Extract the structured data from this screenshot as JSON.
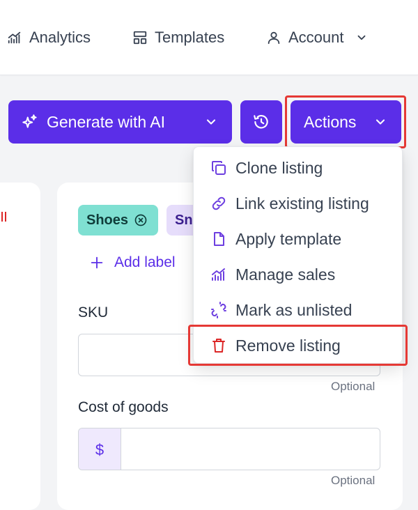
{
  "nav": {
    "items": [
      {
        "label": "Analytics",
        "icon": "chart-icon"
      },
      {
        "label": "Templates",
        "icon": "layout-icon"
      },
      {
        "label": "Account",
        "icon": "user-icon"
      }
    ]
  },
  "toolbar": {
    "generate_label": "Generate with AI",
    "actions_label": "Actions"
  },
  "labels": {
    "chips": [
      "Shoes",
      "Sn"
    ],
    "add_label": "Add label"
  },
  "form": {
    "sku_label": "SKU",
    "sku_value": "",
    "sku_hint": "Optional",
    "cost_label": "Cost of goods",
    "cost_prefix": "$",
    "cost_value": "",
    "cost_hint": "Optional"
  },
  "actions_menu": {
    "items": [
      {
        "label": "Clone listing",
        "icon": "copy-icon"
      },
      {
        "label": "Link existing listing",
        "icon": "link-icon"
      },
      {
        "label": "Apply template",
        "icon": "file-icon"
      },
      {
        "label": "Manage sales",
        "icon": "chart-icon"
      },
      {
        "label": "Mark as unlisted",
        "icon": "unlink-icon"
      },
      {
        "label": "Remove listing",
        "icon": "trash-icon"
      }
    ]
  },
  "colors": {
    "primary": "#5b2ee8",
    "accent_icon": "#6d3fe0",
    "danger": "#dc2626",
    "highlight": "#e53935",
    "chip_teal": "#7fe0d2",
    "chip_purple": "#e6ddfb"
  }
}
